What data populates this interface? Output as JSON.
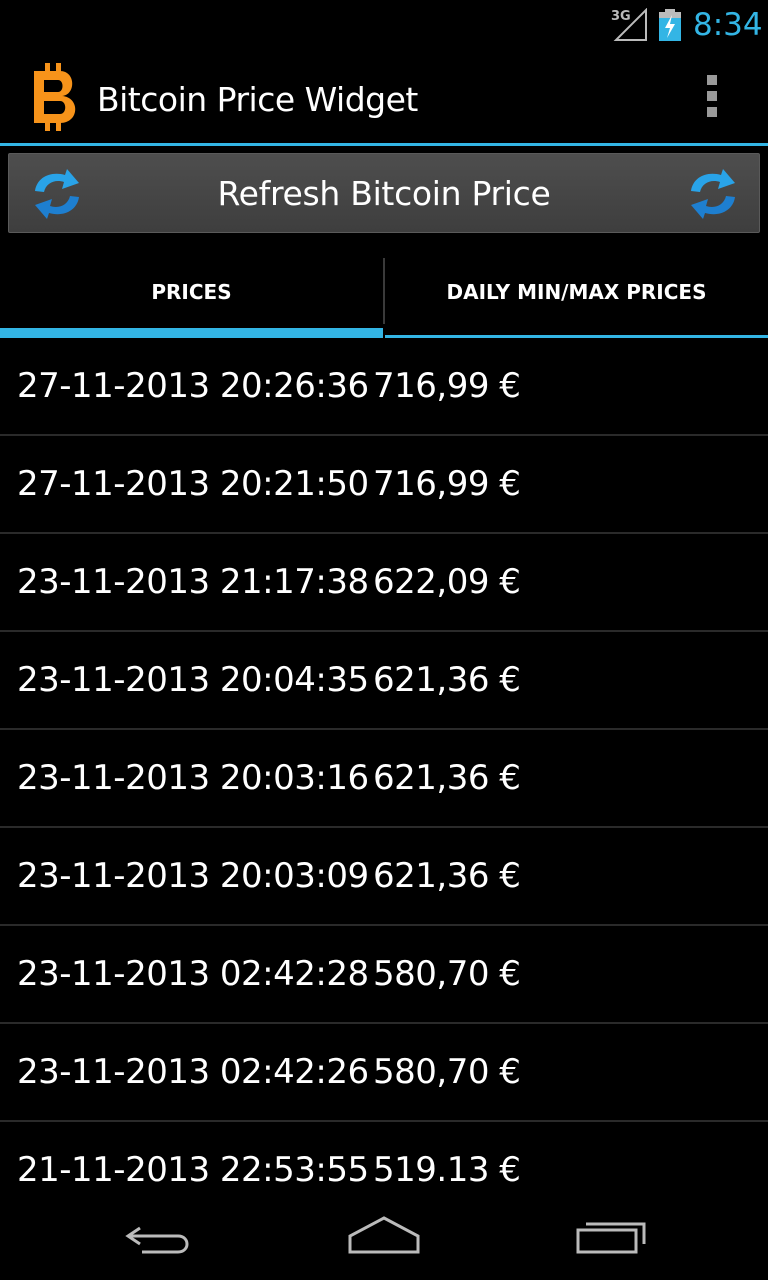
{
  "status_bar": {
    "network": "3G",
    "time": "8:34",
    "icons": [
      "signal-icon",
      "battery-charging-icon"
    ]
  },
  "action_bar": {
    "title": "Bitcoin Price Widget",
    "logo_icon": "bitcoin-logo-icon",
    "menu_icon": "overflow-menu-icon"
  },
  "refresh": {
    "label": "Refresh Bitcoin Price",
    "icon": "refresh-icon"
  },
  "tabs": [
    {
      "label": "PRICES",
      "selected": true
    },
    {
      "label": "DAILY MIN/MAX PRICES",
      "selected": false
    }
  ],
  "prices": [
    {
      "timestamp": "27-11-2013 20:26:36",
      "price": "716,99 €"
    },
    {
      "timestamp": "27-11-2013 20:21:50",
      "price": "716,99 €"
    },
    {
      "timestamp": "23-11-2013 21:17:38",
      "price": "622,09 €"
    },
    {
      "timestamp": "23-11-2013 20:04:35",
      "price": "621,36 €"
    },
    {
      "timestamp": "23-11-2013 20:03:16",
      "price": "621,36 €"
    },
    {
      "timestamp": "23-11-2013 20:03:09",
      "price": "621,36 €"
    },
    {
      "timestamp": "23-11-2013 02:42:28",
      "price": "580,70 €"
    },
    {
      "timestamp": "23-11-2013 02:42:26",
      "price": "580,70 €"
    },
    {
      "timestamp": "21-11-2013 22:53:55",
      "price": "519.13 €"
    }
  ],
  "nav_bar": {
    "icons": [
      "back-icon",
      "home-icon",
      "recent-apps-icon"
    ]
  },
  "colors": {
    "accent": "#33b5e5",
    "bitcoin_orange": "#f7931a",
    "background": "#000000"
  }
}
